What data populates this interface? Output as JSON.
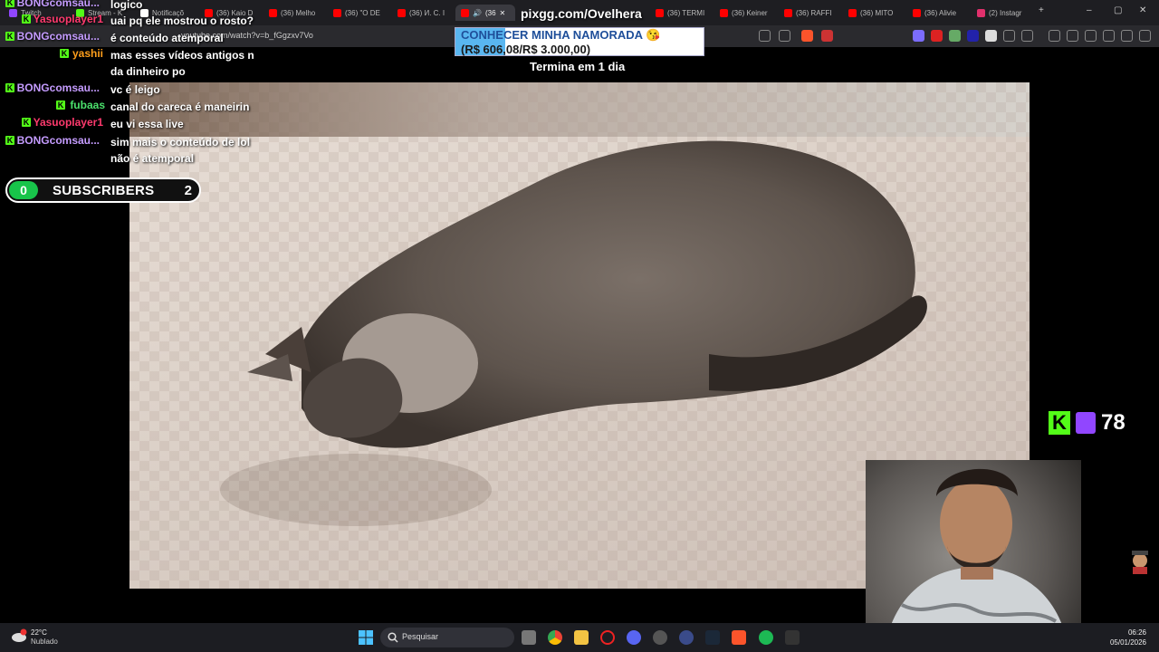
{
  "browser": {
    "tabs": [
      {
        "label": "Twitch",
        "color": "#9146ff"
      },
      {
        "label": "Stream - K",
        "color": "#53fc18"
      },
      {
        "label": "Notificaçõ",
        "color": "#ffffff"
      },
      {
        "label": "(36) Kaio D",
        "color": "#ff0000"
      },
      {
        "label": "(36) Melho",
        "color": "#ff0000"
      },
      {
        "label": "(36) \"O DE",
        "color": "#ff0000"
      },
      {
        "label": "(36) И. С. I",
        "color": "#ff0000"
      },
      {
        "label": "(36",
        "color": "#ff0000",
        "active": true
      },
      {
        "label": "(36) TERMI",
        "color": "#ff0000"
      },
      {
        "label": "(36) Keiner",
        "color": "#ff0000"
      },
      {
        "label": "(36) RAFFI",
        "color": "#ff0000"
      },
      {
        "label": "(36) MITO",
        "color": "#ff0000"
      },
      {
        "label": "(36) Alivie",
        "color": "#ff0000"
      },
      {
        "label": "(2) Instagr",
        "color": "#e1306c"
      }
    ],
    "url": "youtube.com/watch?v=b_fGgzxv7Vo"
  },
  "chat": {
    "messages": [
      {
        "user": "BONGcomsau...",
        "text": "logico",
        "user_color": "#c59cff"
      },
      {
        "user": "Yasuoplayer1",
        "text": "uai pq ele mostrou o rosto?",
        "user_color": "#ff3a6e"
      },
      {
        "user": "BONGcomsau...",
        "text": "é conteúdo atemporal",
        "user_color": "#c59cff"
      },
      {
        "user": "yashii",
        "text": "mas esses vídeos antigos n da dinheiro po",
        "user_color": "#ff9f1c"
      },
      {
        "user": "BONGcomsau...",
        "text": "vc é leigo",
        "user_color": "#c59cff"
      },
      {
        "user": "fubaas",
        "text": "canal do careca é maneirin",
        "user_color": "#4be06c"
      },
      {
        "user": "Yasuoplayer1",
        "text": "eu vi essa live",
        "user_color": "#ff3a6e"
      },
      {
        "user": "BONGcomsau...",
        "text": "sim mais o conteúdo de lol não é atemporal",
        "user_color": "#c59cff"
      }
    ]
  },
  "subscribers": {
    "current": "0",
    "label": "SUBSCRIBERS",
    "goal": "2"
  },
  "pix_goal": {
    "url": "pixgg.com/Ovelhera",
    "title": "CONHECER MINHA NAMORADA 😘",
    "amount": "(R$ 606,08/R$ 3.000,00)",
    "ends": "Termina em 1 dia",
    "progress": 0.2
  },
  "viewers": {
    "count": "78",
    "kick_letter": "K"
  },
  "taskbar": {
    "weather_temp": "22°C",
    "weather_cond": "Nublado",
    "search_placeholder": "Pesquisar",
    "time": "06:26",
    "date": "05/01/2026"
  }
}
